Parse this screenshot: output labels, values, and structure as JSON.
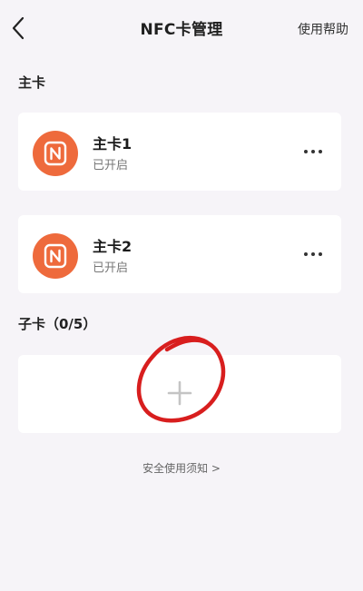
{
  "header": {
    "title": "NFC卡管理",
    "help_label": "使用帮助"
  },
  "primary_section": {
    "title": "主卡",
    "cards": [
      {
        "name": "主卡1",
        "status": "已开启"
      },
      {
        "name": "主卡2",
        "status": "已开启"
      }
    ]
  },
  "sub_section": {
    "title": "子卡（0/5）"
  },
  "footer": {
    "safety_link": "安全使用须知 >"
  },
  "colors": {
    "accent": "#ee6a3c",
    "annotation": "#d81e1e",
    "background": "#f6f4f8"
  },
  "icons": {
    "back": "chevron-left-icon",
    "nfc": "nfc-icon",
    "more": "more-dots-icon",
    "add": "plus-icon"
  }
}
